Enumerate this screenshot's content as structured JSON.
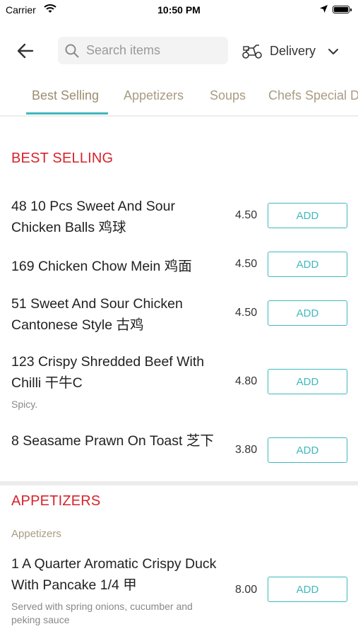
{
  "status_bar": {
    "carrier": "Carrier",
    "time": "10:50 PM"
  },
  "header": {
    "search_placeholder": "Search items",
    "delivery_label": "Delivery"
  },
  "tabs": [
    {
      "label": "Best Selling",
      "active": true
    },
    {
      "label": "Appetizers",
      "active": false
    },
    {
      "label": "Soups",
      "active": false
    },
    {
      "label": "Chefs Special Dishes",
      "active": false
    }
  ],
  "colors": {
    "accent": "#3fb8bd",
    "section_title": "#d6232d",
    "tab_text": "#a89c82"
  },
  "sections": {
    "best_selling": {
      "title": "BEST SELLING",
      "items": [
        {
          "name": "48 10 Pcs Sweet And Sour Chicken Balls 鸡球",
          "price": "4.50",
          "add_label": "ADD"
        },
        {
          "name": "169 Chicken Chow Mein 鸡面",
          "price": "4.50",
          "add_label": "ADD"
        },
        {
          "name": "51 Sweet And Sour Chicken Cantonese Style 古鸡",
          "price": "4.50",
          "add_label": "ADD"
        },
        {
          "name": "123 Crispy Shredded Beef With Chilli 干牛C",
          "description": "Spicy.",
          "price": "4.80",
          "add_label": "ADD"
        },
        {
          "name": "8 Seasame Prawn On Toast 芝下",
          "price": "3.80",
          "add_label": "ADD"
        }
      ]
    },
    "appetizers": {
      "title": "APPETIZERS",
      "subheading": "Appetizers",
      "items": [
        {
          "name": "1 A Quarter Aromatic Crispy Duck With Pancake 1/4 甲",
          "description": "Served with spring onions, cucumber and peking sauce",
          "price": "8.00",
          "add_label": "ADD"
        }
      ]
    }
  }
}
